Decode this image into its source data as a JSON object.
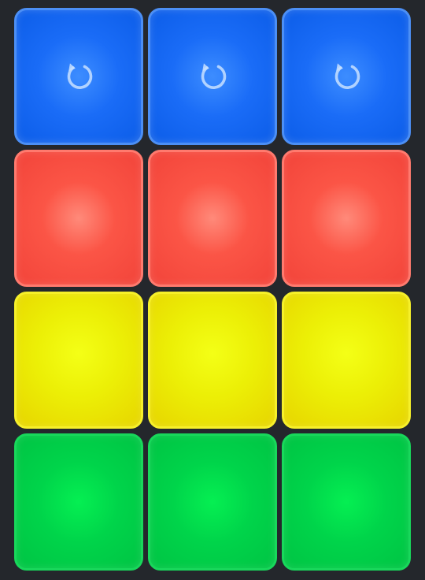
{
  "board": {
    "rows": [
      {
        "color_name": "blue",
        "color": "#1a6cf7",
        "pads": [
          {
            "icon": "rotate-icon"
          },
          {
            "icon": "rotate-icon"
          },
          {
            "icon": "rotate-icon"
          }
        ]
      },
      {
        "color_name": "red",
        "color": "#f2443a",
        "pads": [
          {},
          {},
          {}
        ]
      },
      {
        "color_name": "yellow",
        "color": "#ecef06",
        "pads": [
          {},
          {},
          {}
        ]
      },
      {
        "color_name": "green",
        "color": "#00d44a",
        "pads": [
          {},
          {},
          {}
        ]
      }
    ]
  }
}
